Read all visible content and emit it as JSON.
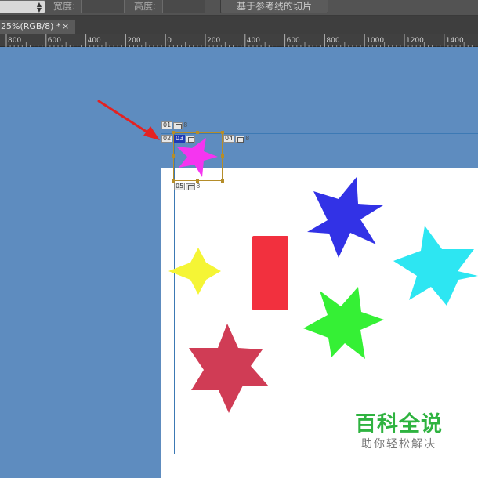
{
  "options_bar": {
    "width_label": "宽度:",
    "height_label": "高度:",
    "slice_from_guides_label": "基于参考线的切片",
    "style_select_icon": "up-down-arrows-icon"
  },
  "document_tab": {
    "title": "25%(RGB/8) *",
    "close_glyph": "×"
  },
  "ruler": {
    "unit": "px",
    "ticks": [
      "800",
      "600",
      "400",
      "200",
      "0",
      "200",
      "400",
      "600",
      "800",
      "1000",
      "1200",
      "1400"
    ]
  },
  "slices": [
    {
      "number": "01",
      "link_glyph": "8"
    },
    {
      "number": "02",
      "link_glyph": ""
    },
    {
      "number": "03",
      "link_glyph": "",
      "selected": true
    },
    {
      "number": "04",
      "link_glyph": "8"
    },
    {
      "number": "05",
      "link_glyph": "8"
    }
  ],
  "shapes": {
    "magenta_star": "#f535f0",
    "blue_star": "#3232e6",
    "cyan_star": "#2de6f2",
    "yellow_star": "#f5f535",
    "red_rectangle": "#f2303e",
    "green_star": "#35f035",
    "crimson_star": "#d03c55"
  },
  "annotation": {
    "arrow_color": "#e32222"
  },
  "watermark": {
    "title": "百科全说",
    "subtitle": "助你轻松解决",
    "color": "#2fb340"
  }
}
